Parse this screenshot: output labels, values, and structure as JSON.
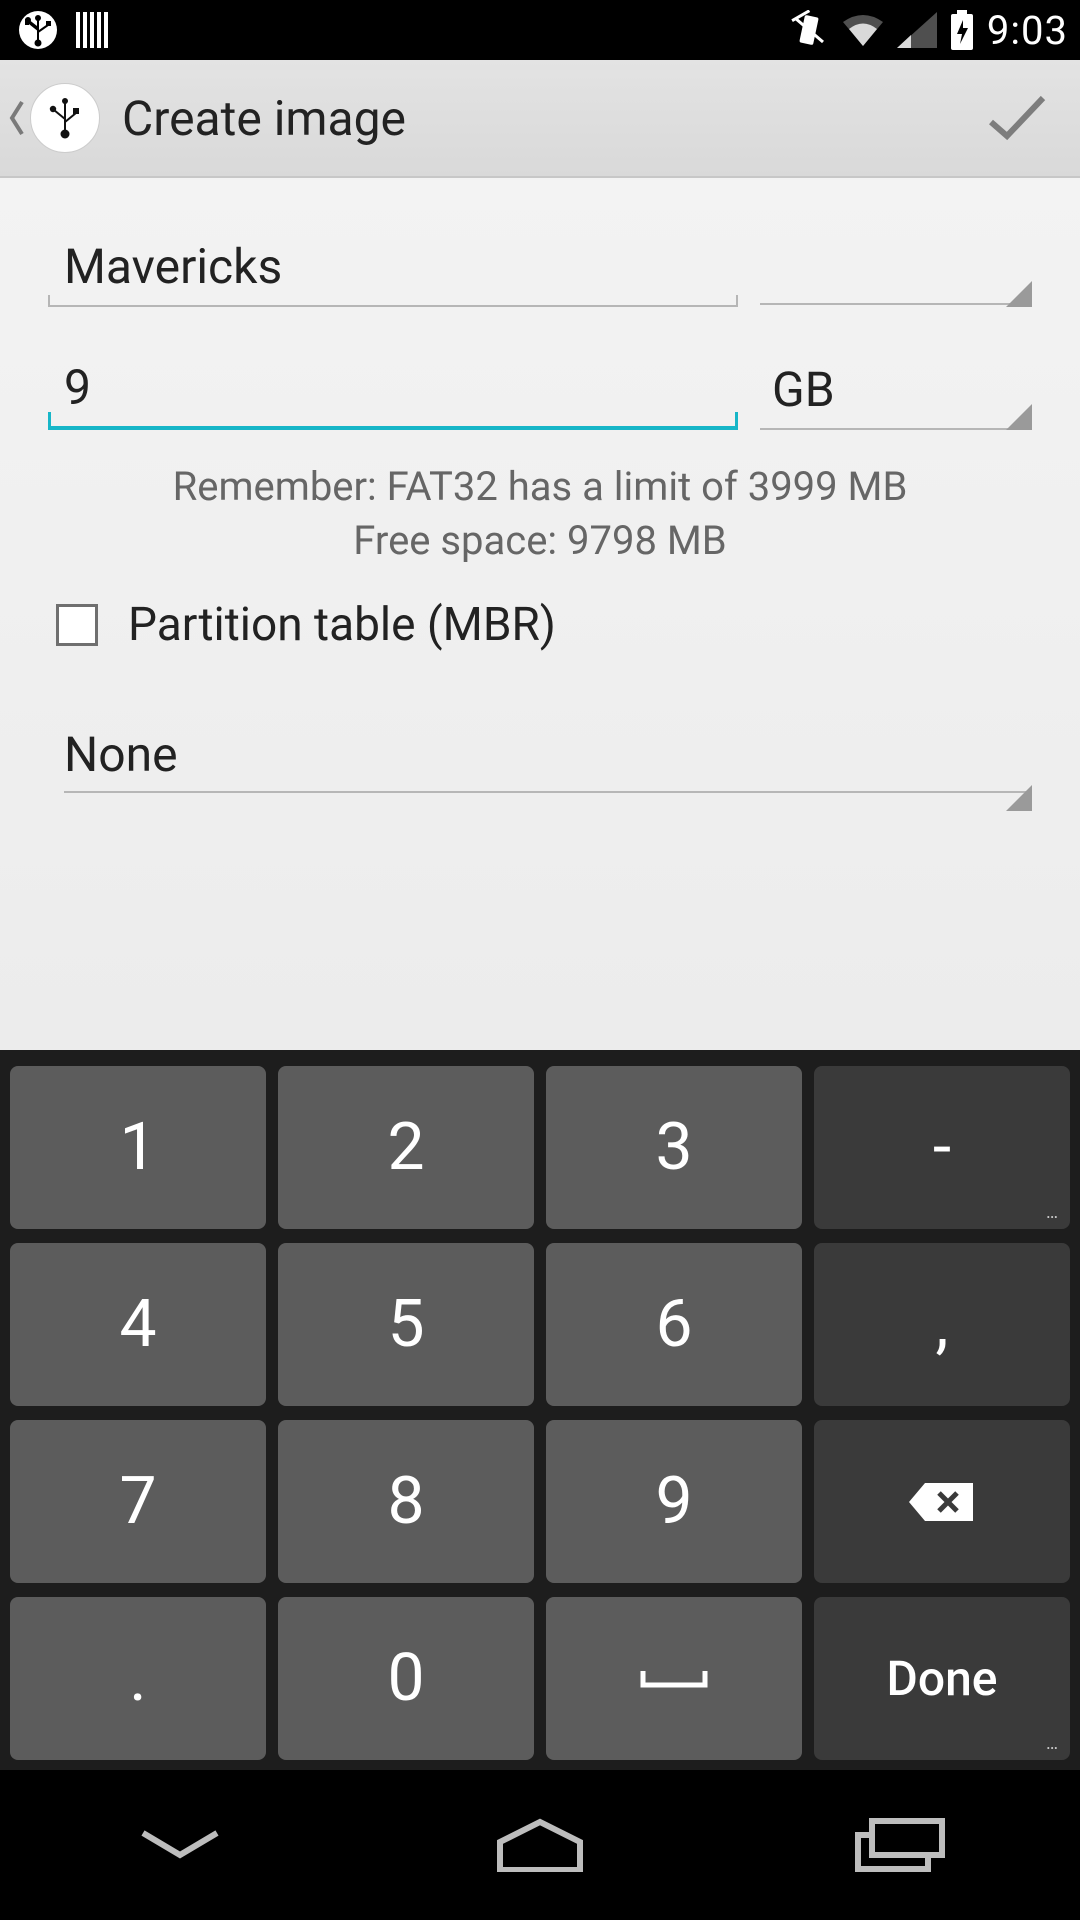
{
  "statusbar": {
    "time": "9:03"
  },
  "actionbar": {
    "title": "Create image"
  },
  "form": {
    "name_value": "Mavericks",
    "size_value": "9",
    "unit": "GB",
    "hint1": "Remember: FAT32 has a limit of 3999 MB",
    "hint2": "Free space: 9798 MB",
    "checkbox_label": "Partition table (MBR)",
    "checkbox_checked": false,
    "filesystem": "None"
  },
  "keyboard": {
    "keys": {
      "k1": "1",
      "k2": "2",
      "k3": "3",
      "minus": "-",
      "k4": "4",
      "k5": "5",
      "k6": "6",
      "comma": ",",
      "k7": "7",
      "k8": "8",
      "k9": "9",
      "period": ".",
      "k0": "0",
      "done": "Done"
    }
  }
}
